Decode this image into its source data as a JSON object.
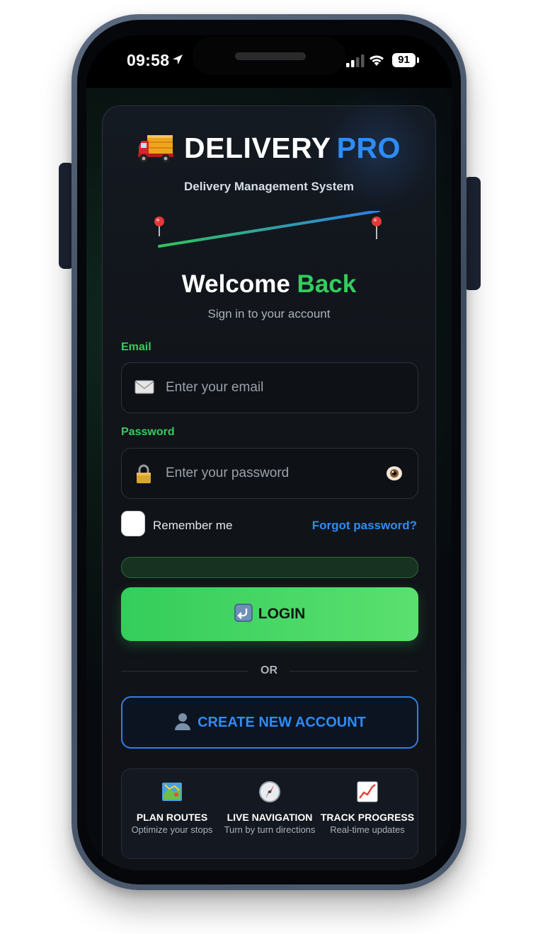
{
  "status_bar": {
    "time": "09:58",
    "battery": "91"
  },
  "brand": {
    "word": "DELIVERY",
    "accent": "PRO",
    "subtitle": "Delivery Management System"
  },
  "welcome": {
    "title": "Welcome",
    "accent": "Back",
    "subtitle": "Sign in to your account"
  },
  "form": {
    "email_label": "Email",
    "email_placeholder": "Enter your email",
    "password_label": "Password",
    "password_placeholder": "Enter your password",
    "remember_label": "Remember me",
    "forgot_label": "Forgot password?"
  },
  "buttons": {
    "login": "LOGIN",
    "or": "OR",
    "create": "CREATE NEW ACCOUNT"
  },
  "features": [
    {
      "icon": "map-icon",
      "title": "PLAN ROUTES",
      "desc": "Optimize your stops"
    },
    {
      "icon": "compass-icon",
      "title": "LIVE NAVIGATION",
      "desc": "Turn by turn directions"
    },
    {
      "icon": "chart-icon",
      "title": "TRACK PROGRESS",
      "desc": "Real-time updates"
    }
  ],
  "colors": {
    "green": "#33cd5e",
    "blue": "#2f8cf5",
    "card": "#111419"
  }
}
